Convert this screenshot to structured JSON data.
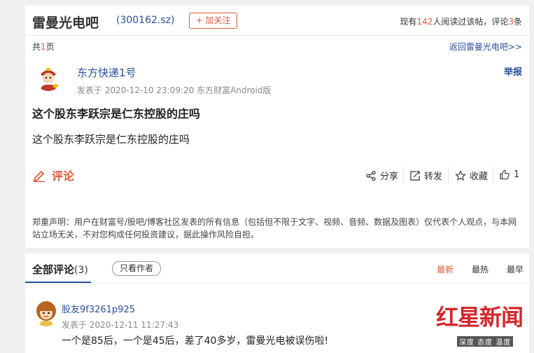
{
  "header": {
    "forum_title": "雷曼光电吧",
    "stock_code": "(300162.sz)",
    "follow_label": "+ 加关注",
    "stats_prefix": "现有",
    "readers": "142",
    "stats_mid": "人阅读过该帖，评论",
    "comments": "3",
    "stats_suffix": "条"
  },
  "pagination": {
    "prefix": "共",
    "pages": "1",
    "suffix": "页",
    "back_link": "返回雷曼光电吧>>"
  },
  "post": {
    "author": "东方快递1号",
    "meta": "发表于 2020-12-10 23:09:20 东方财富Android版",
    "report": "举报",
    "title": "这个股东李跃宗是仁东控股的庄吗",
    "body": "这个股东李跃宗是仁东控股的庄吗"
  },
  "actions": {
    "comment": "评论",
    "share": "分享",
    "repost": "转发",
    "favorite": "收藏",
    "like_count": "1"
  },
  "disclaimer": "郑重声明：用户在财富号/股吧/博客社区发表的所有信息（包括但不限于文字、视频、音频、数据及图表）仅代表个人观点，与本网站立场无关，不对您构成任何投资建议，据此操作风险自担。",
  "comments_section": {
    "tab_label": "全部评论",
    "count": "(3)",
    "only_author": "只看作者",
    "sort_options": [
      "最新",
      "最热",
      "最早"
    ],
    "items": [
      {
        "user": "股友9f3261p925",
        "meta": "发表于 2020-12-11 11:27:43",
        "text": "一个是85后，一个是45后，差了40多岁，雷曼光电被误伤啦!"
      }
    ]
  },
  "watermark": {
    "main": "红星新闻",
    "sub": "深度 态度 温度"
  },
  "colors": {
    "accent": "#e05a3a",
    "link": "#2a4f9e"
  }
}
